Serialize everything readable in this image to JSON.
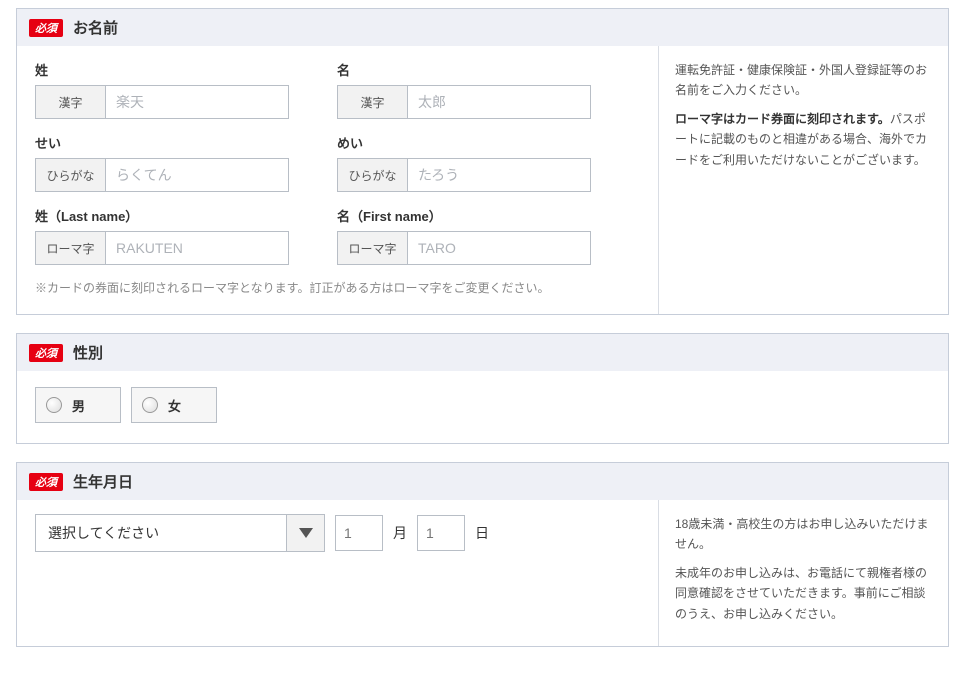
{
  "required_badge": "必須",
  "name_section": {
    "title": "お名前",
    "sei_label": "姓",
    "mei_label": "名",
    "sei_kana_label": "せい",
    "mei_kana_label": "めい",
    "sei_roma_label": "姓（Last name）",
    "mei_roma_label": "名（First name）",
    "prefix_kanji": "漢字",
    "prefix_hira": "ひらがな",
    "prefix_roma": "ローマ字",
    "ph_sei_kanji": "楽天",
    "ph_mei_kanji": "太郎",
    "ph_sei_kana": "らくてん",
    "ph_mei_kana": "たろう",
    "ph_sei_roma": "RAKUTEN",
    "ph_mei_roma": "TARO",
    "note": "※カードの券面に刻印されるローマ字となります。訂正がある方はローマ字をご変更ください。",
    "info1": "運転免許証・健康保険証・外国人登録証等のお名前をご入力ください。",
    "info2_bold": "ローマ字はカード券面に刻印されます。",
    "info2_rest": "パスポートに記載のものと相違がある場合、海外でカードをご利用いただけないことがございます。"
  },
  "gender_section": {
    "title": "性別",
    "male": "男",
    "female": "女"
  },
  "birth_section": {
    "title": "生年月日",
    "select_placeholder": "選択してください",
    "month_ph": "1",
    "month_unit": "月",
    "day_ph": "1",
    "day_unit": "日",
    "info1": "18歳未満・高校生の方はお申し込みいただけません。",
    "info2": "未成年のお申し込みは、お電話にて親権者様の同意確認をさせていただきます。事前にご相談のうえ、お申し込みください。"
  }
}
